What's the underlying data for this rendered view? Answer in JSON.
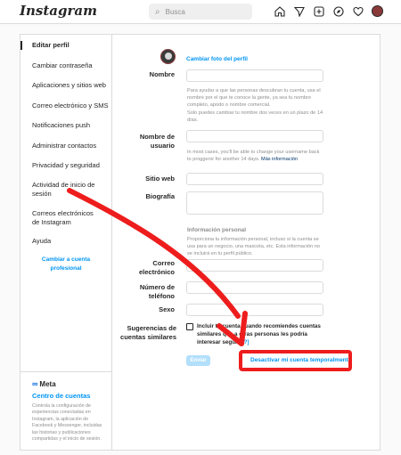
{
  "topbar": {
    "logo": "Instagram",
    "search_placeholder": "Busca",
    "icons": [
      "home-icon",
      "send-icon",
      "new-post-icon",
      "explore-icon",
      "heart-icon",
      "avatar"
    ]
  },
  "sidebar": {
    "items": [
      {
        "label": "Editar perfil",
        "active": true
      },
      {
        "label": "Cambiar contraseña"
      },
      {
        "label": "Aplicaciones y sitios web"
      },
      {
        "label": "Correo electrónico y SMS"
      },
      {
        "label": "Notificaciones push"
      },
      {
        "label": "Administrar contactos"
      },
      {
        "label": "Privacidad y seguridad"
      },
      {
        "label": "Actividad de inicio de sesión"
      },
      {
        "label": "Correos electrónicos de Instagram"
      },
      {
        "label": "Ayuda"
      }
    ],
    "switch_pro": "Cambiar a cuenta profesional",
    "meta": {
      "logo": "Meta",
      "title": "Centro de cuentas",
      "description": "Controla la configuración de experiencias conectadas en Instagram, la aplicación de Facebook y Messenger, incluidas las historias y publicaciones compartidas y el inicio de sesión."
    }
  },
  "form": {
    "change_photo": "Cambiar foto del perfil",
    "name_label": "Nombre",
    "name_hint1": "Para ayudar a que las personas descubran tu cuenta, usa el nombre por el que te conoce la gente, ya sea tu nombre completo, apodo o nombre comercial.",
    "name_hint2": "Solo puedes cambiar tu nombre dos veces en un plazo de 14 días.",
    "username_label": "Nombre de usuario",
    "username_hint": "In most cases, you'll be able to change your username back to proggerxr for another 14 days.",
    "username_hint_link": "Más información",
    "website_label": "Sitio web",
    "bio_label": "Biografía",
    "personal_title": "Información personal",
    "personal_hint": "Proporciona tu información personal, incluso si la cuenta se usa para un negocio, una mascota, etc. Esta información no se incluirá en tu perfil público.",
    "email_label": "Correo electrónico",
    "phone_label": "Número de teléfono",
    "gender_label": "Sexo",
    "suggestions_label": "Sugerencias de cuentas similares",
    "suggestions_text": "Incluir tu cuenta cuando recomiendes cuentas similares que a otras personas les podría interesar seguir.",
    "suggestions_help": "[?]",
    "submit": "Enviar",
    "deactivate": "Desactivar mi cuenta temporalmente"
  },
  "annotation": {
    "color": "#ee1d1d"
  }
}
